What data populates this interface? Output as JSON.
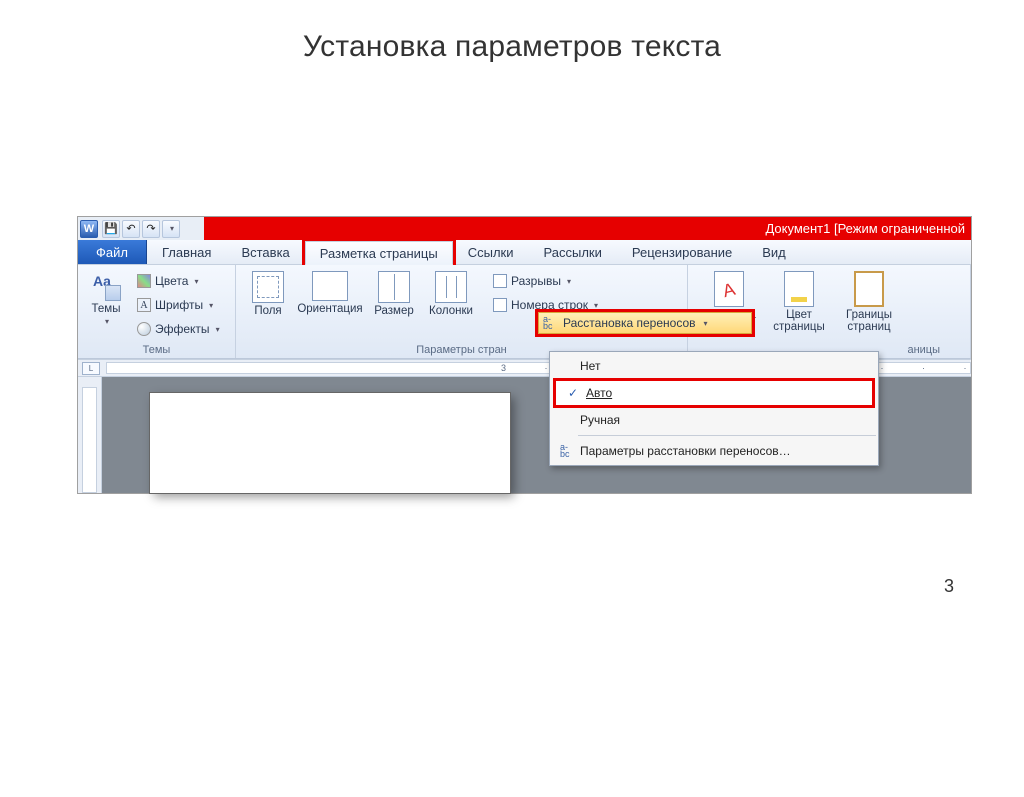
{
  "slide": {
    "title": "Установка параметров текста",
    "page_number": "3"
  },
  "titlebar": {
    "doc_title": "Документ1 [Режим ограниченной"
  },
  "tabs": {
    "file": "Файл",
    "home": "Главная",
    "insert": "Вставка",
    "page_layout": "Разметка страницы",
    "references": "Ссылки",
    "mailings": "Рассылки",
    "review": "Рецензирование",
    "view": "Вид"
  },
  "themes_group": {
    "label": "Темы",
    "themes_btn": "Темы",
    "colors": "Цвета",
    "fonts": "Шрифты",
    "effects": "Эффекты"
  },
  "page_setup_group": {
    "label": "Параметры стран",
    "margins": "Поля",
    "orientation": "Ориентация",
    "size": "Размер",
    "columns": "Колонки",
    "breaks": "Разрывы",
    "line_numbers": "Номера строк",
    "hyphenation": "Расстановка переносов"
  },
  "page_bg_group": {
    "label": "аницы",
    "watermark": "Подложка",
    "page_color": "Цвет страницы",
    "page_borders": "Границы страниц"
  },
  "hyph_menu": {
    "none": "Нет",
    "auto": "Авто",
    "manual": "Ручная",
    "options": "Параметры расстановки переносов…"
  },
  "ruler": {
    "ticks": "3 · · · 2 · · · 1 · · ·"
  }
}
